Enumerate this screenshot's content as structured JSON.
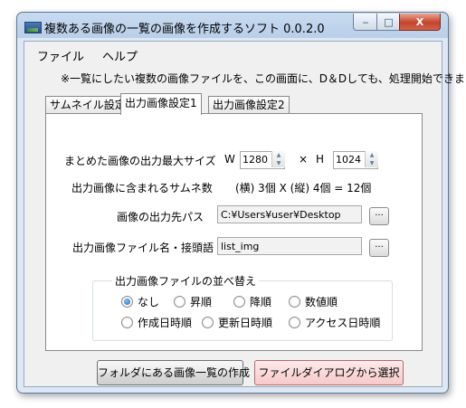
{
  "window": {
    "title": "複数ある画像の一覧の画像を作成するソフト 0.0.2.0",
    "min_glyph": "‒",
    "max_glyph": "□",
    "close_glyph": "X"
  },
  "menu": {
    "file": "ファイル",
    "help": "ヘルプ"
  },
  "notice": "※一覧にしたい複数の画像ファイルを、この画面に、D＆Dしても、処理開始できます。",
  "tabs": [
    {
      "label": "サムネイル設定",
      "active": false
    },
    {
      "label": "出力画像設定1",
      "active": true
    },
    {
      "label": "出力画像設定2",
      "active": false
    }
  ],
  "settings": {
    "max_size_label": "まとめた画像の出力最大サイズ",
    "w_label": "W",
    "width_value": "1280",
    "times": "×",
    "h_label": "H",
    "height_value": "1024",
    "thumb_count_label": "出力画像に含まれるサムネ数",
    "thumb_count_value": "(横) 3個 X (縦) 4個 = 12個",
    "output_path_label": "画像の出力先パス",
    "output_path_value": "C:¥Users¥user¥Desktop",
    "browse_label": "...",
    "prefix_label": "出力画像ファイル名・接頭語",
    "prefix_value": "list_img"
  },
  "sort": {
    "title": "出力画像ファイルの並べ替え",
    "options": [
      {
        "label": "なし",
        "selected": true
      },
      {
        "label": "昇順",
        "selected": false
      },
      {
        "label": "降順",
        "selected": false
      },
      {
        "label": "数値順",
        "selected": false
      },
      {
        "label": "作成日時順",
        "selected": false
      },
      {
        "label": "更新日時順",
        "selected": false
      },
      {
        "label": "アクセス日時順",
        "selected": false
      }
    ]
  },
  "buttons": {
    "folder_list": "フォルダにある画像一覧の作成",
    "file_dialog": "ファイルダイアログから選択"
  },
  "colors": {
    "accent": "#1c63b7",
    "close": "#c7442b",
    "primary_button": "#f6caca"
  }
}
